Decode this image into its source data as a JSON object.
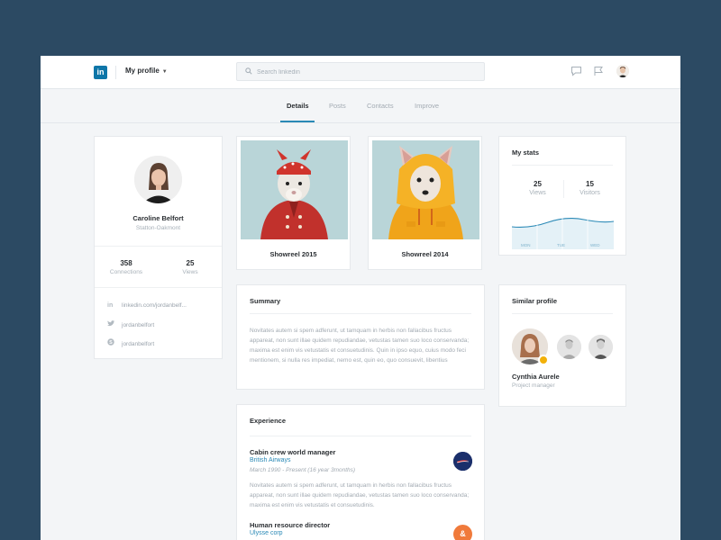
{
  "header": {
    "logo_text": "in",
    "profile_menu_label": "My profile",
    "search_placeholder": "Search linkedin"
  },
  "tabs": [
    {
      "label": "Details",
      "active": true
    },
    {
      "label": "Posts",
      "active": false
    },
    {
      "label": "Contacts",
      "active": false
    },
    {
      "label": "Improve",
      "active": false
    }
  ],
  "profile": {
    "name": "Caroline Belfort",
    "location": "Statton-Oakmont",
    "stats": [
      {
        "value": "358",
        "label": "Connections"
      },
      {
        "value": "25",
        "label": "Views"
      }
    ],
    "links": [
      {
        "icon": "linkedin-icon",
        "glyph": "in",
        "text": "linkedin.com/jordanbelf..."
      },
      {
        "icon": "twitter-icon",
        "glyph": "🐦",
        "text": "jordanbelfort"
      },
      {
        "icon": "skype-icon",
        "glyph": "S",
        "text": "jordanbelfort"
      }
    ]
  },
  "showreels": [
    {
      "title": "Showreel 2015"
    },
    {
      "title": "Showreel 2014"
    }
  ],
  "my_stats": {
    "title": "My stats",
    "stats": [
      {
        "value": "25",
        "label": "Views"
      },
      {
        "value": "15",
        "label": "Visitors"
      }
    ],
    "chart_days": [
      "MON",
      "TUE",
      "WED"
    ]
  },
  "summary": {
    "title": "Summary",
    "text": "Novitates autem si spem adferunt, ut tamquam in herbis non fallacibus fructus appareat, non sunt illae quidem repudiandae, vetustas tamen suo loco conservanda; maxima est enim vis vetustatis et consuetudinis. Quin in ipso equo, cuius modo feci mentionem, si nulla res impediat, nemo est, quin eo, quo consuevit, libentius"
  },
  "similar_profile": {
    "title": "Similar profile",
    "name": "Cynthia Aurele",
    "role": "Project manager"
  },
  "experience": {
    "title": "Experience",
    "items": [
      {
        "role": "Cabin crew world manager",
        "company": "British Airways",
        "dates": "March 1990 - Present (16 year 3months)",
        "description": "Novitates autem si spem adferunt, ut tamquam in herbis non fallacibus fructus appareat, non sunt illae quidem repudiandae, vetustas tamen suo loco conservanda; maxima est enim vis vetustatis et consuetudinis.",
        "logo_color": "#1b2f6b",
        "logo_text": ""
      },
      {
        "role": "Human resource director",
        "company": "Ulysse corp",
        "logo_color": "#f07a3b",
        "logo_text": "&"
      }
    ]
  },
  "colors": {
    "background": "#2c4a63",
    "accent": "#2a89b6",
    "linkedin_blue": "#0e76a8",
    "chart_fill": "#e4f1f7"
  }
}
